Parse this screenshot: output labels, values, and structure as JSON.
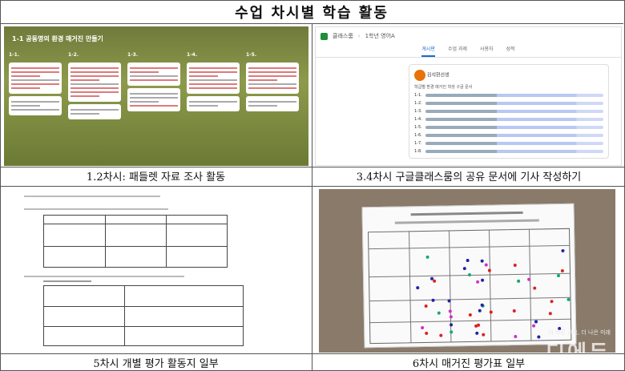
{
  "title": "수업 차시별 학습 활동",
  "captions": [
    "1.2차시: 패들렛 자료 조사 활동",
    "3.4차시 구글클래스룸의 공유 문서에 기사 작성하기",
    "5차시 개별 평가 활동지 일부",
    "6차시 매거진 평가표 일부"
  ],
  "padlet": {
    "heading": "1-1 공동명의 환경 매거진 만들기",
    "columns": [
      "1-1.",
      "1-2.",
      "1-3.",
      "1-4.",
      "1-5."
    ]
  },
  "classroom": {
    "app_name": "클래스룸",
    "class_name": "1학년 영어A",
    "tabs": [
      "게시판",
      "수업 과제",
      "사용자",
      "성적"
    ],
    "active_tab": "게시판",
    "poster": "김석현선생",
    "post_text": "학급별 환경 매거진 학생 구글 문서",
    "links": [
      "1-1.",
      "1-2.",
      "1-3.",
      "1-4.",
      "1-5.",
      "1-6.",
      "1-7.",
      "1-8."
    ]
  },
  "watermark": {
    "tagline": "더 바른 교육, 더 나은 미래",
    "logo": "디에듀"
  }
}
